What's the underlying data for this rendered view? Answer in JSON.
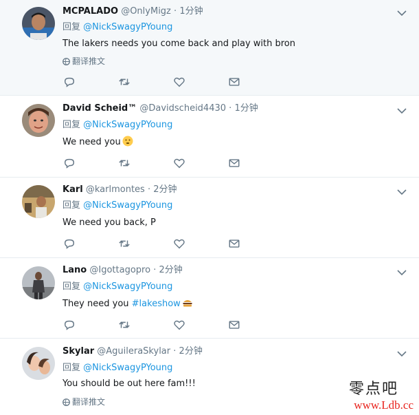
{
  "tweets": [
    {
      "name": "MCPALADO",
      "handle": "@OnlyMigz",
      "time": "1分钟",
      "reply_prefix": "回复",
      "mention": "@NickSwagyPYoung",
      "text": "The lakers needs you come back and play with bron",
      "translate": "翻译推文"
    },
    {
      "name": "David Scheid™",
      "handle": "@Davidscheid4430",
      "time": "1分钟",
      "reply_prefix": "回复",
      "mention": "@NickSwagyPYoung",
      "text": "We need you",
      "emoji": "smiling-face-icon"
    },
    {
      "name": "Karl",
      "handle": "@karlmontes",
      "time": "2分钟",
      "reply_prefix": "回复",
      "mention": "@NickSwagyPYoung",
      "text": "We need you back, P"
    },
    {
      "name": "Lano",
      "handle": "@Igottagopro",
      "time": "2分钟",
      "reply_prefix": "回复",
      "mention": "@NickSwagyPYoung",
      "text": "They need you",
      "hashtag": "#lakeshow",
      "emoji": "burger-icon"
    },
    {
      "name": "Skylar",
      "handle": "@AguileraSkylar",
      "time": "2分钟",
      "reply_prefix": "回复",
      "mention": "@NickSwagyPYoung",
      "text": "You should be out here fam!!!",
      "translate": "翻译推文"
    }
  ],
  "separator": "·",
  "watermark": {
    "chinese": "零点吧",
    "url": "www.Ldb.cc"
  },
  "colors": {
    "link": "#1b95e0",
    "secondary": "#657786",
    "highlight_bg": "#f5f8fa",
    "watermark_url": "#e8251f"
  }
}
